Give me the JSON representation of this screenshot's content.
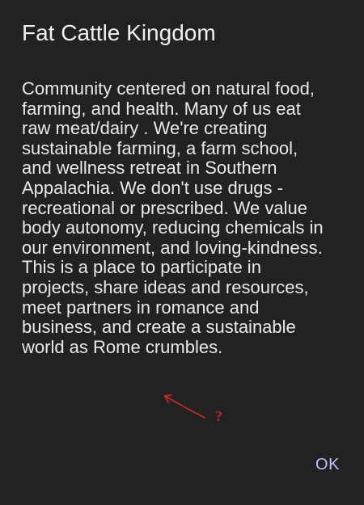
{
  "dialog": {
    "title": "Fat Cattle Kingdom",
    "body_lines": [
      "Community centered on natural food,",
      "farming, and health. Many of us eat",
      "raw meat/dairy . We're creating",
      "sustainable farming, a farm school,",
      "and wellness retreat in Southern",
      "Appalachia. We don't use drugs -",
      "recreational or prescribed. We value",
      "body autonomy, reducing chemicals in",
      "our environment, and  loving-kindness.",
      "This is a place to participate in",
      "projects, share ideas and resources,",
      "meet partners in romance and",
      "business, and create a sustainable",
      "world as Rome crumbles."
    ],
    "ok_label": "OK"
  },
  "annotation": {
    "mark": "?",
    "color": "#c0282a"
  },
  "colors": {
    "background": "#222222",
    "text": "#e9e9e9",
    "accent": "#b8c0ff"
  }
}
